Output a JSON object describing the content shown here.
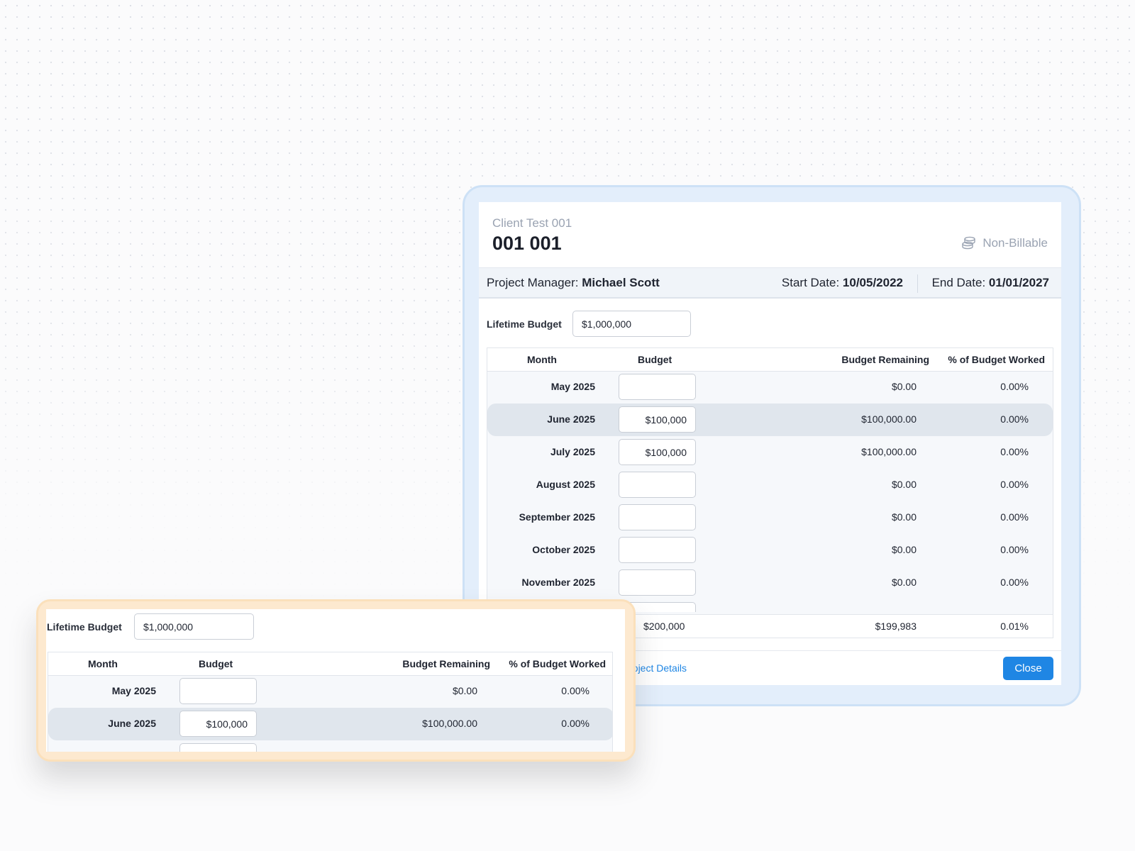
{
  "modal": {
    "client_name": "Client Test 001",
    "project_title": "001 001",
    "billing_status": "Non-Billable",
    "project_manager_label": "Project Manager:",
    "project_manager": "Michael Scott",
    "start_date_label": "Start Date:",
    "start_date": "10/05/2022",
    "end_date_label": "End Date:",
    "end_date": "01/01/2027",
    "lifetime_budget_label": "Lifetime Budget",
    "lifetime_budget_value": "$1,000,000",
    "columns": [
      "Month",
      "Budget",
      "Budget Remaining",
      "% of Budget Worked"
    ],
    "rows": [
      {
        "month": "May 2025",
        "budget": "",
        "remaining": "$0.00",
        "pct": "0.00%"
      },
      {
        "month": "June 2025",
        "budget": "$100,000",
        "remaining": "$100,000.00",
        "pct": "0.00%"
      },
      {
        "month": "July 2025",
        "budget": "$100,000",
        "remaining": "$100,000.00",
        "pct": "0.00%"
      },
      {
        "month": "August 2025",
        "budget": "",
        "remaining": "$0.00",
        "pct": "0.00%"
      },
      {
        "month": "September 2025",
        "budget": "",
        "remaining": "$0.00",
        "pct": "0.00%"
      },
      {
        "month": "October 2025",
        "budget": "",
        "remaining": "$0.00",
        "pct": "0.00%"
      },
      {
        "month": "November 2025",
        "budget": "",
        "remaining": "$0.00",
        "pct": "0.00%"
      }
    ],
    "totals": {
      "budget": "$200,000",
      "remaining": "$199,983",
      "pct": "0.01%"
    },
    "edit_link": "t Project Details",
    "close_label": "Close"
  },
  "inset": {
    "lifetime_budget_label": "Lifetime Budget",
    "lifetime_budget_value": "$1,000,000",
    "columns": [
      "Month",
      "Budget",
      "Budget Remaining",
      "% of Budget Worked"
    ],
    "rows": [
      {
        "month": "May 2025",
        "budget": "",
        "remaining": "$0.00",
        "pct": "0.00%"
      },
      {
        "month": "June 2025",
        "budget": "$100,000",
        "remaining": "$100,000.00",
        "pct": "0.00%"
      }
    ]
  }
}
